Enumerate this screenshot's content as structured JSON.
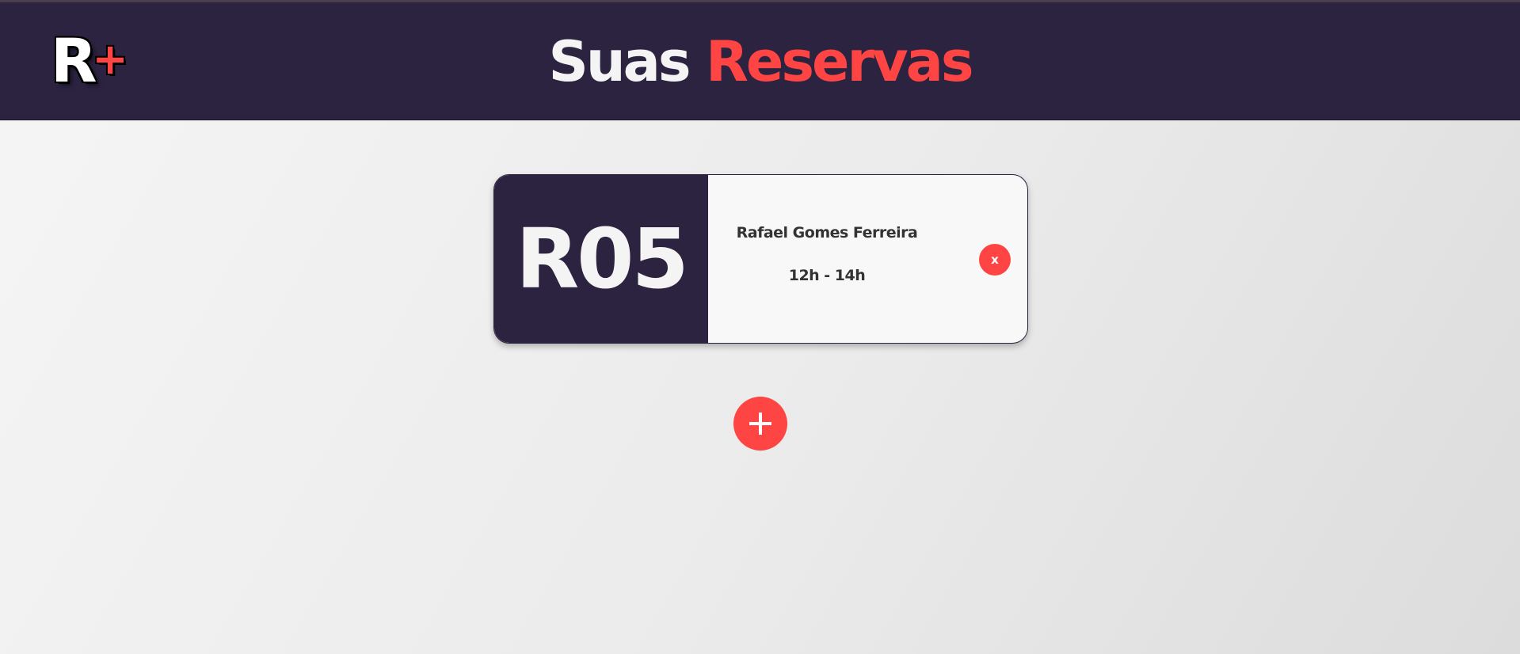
{
  "header": {
    "logo": {
      "letter": "R",
      "plus": "+"
    },
    "title_part1": "Suas",
    "title_part2": "Reservas"
  },
  "reservations": [
    {
      "code": "R05",
      "name": "Rafael Gomes Ferreira",
      "time": "12h - 14h",
      "delete_label": "x"
    }
  ],
  "actions": {
    "add_icon": "plus-icon"
  },
  "colors": {
    "header_bg": "#2c2340",
    "accent": "#ff4444",
    "card_bg": "#f8f8f8",
    "text_dark": "#333333",
    "text_light": "#f4f4f4"
  }
}
